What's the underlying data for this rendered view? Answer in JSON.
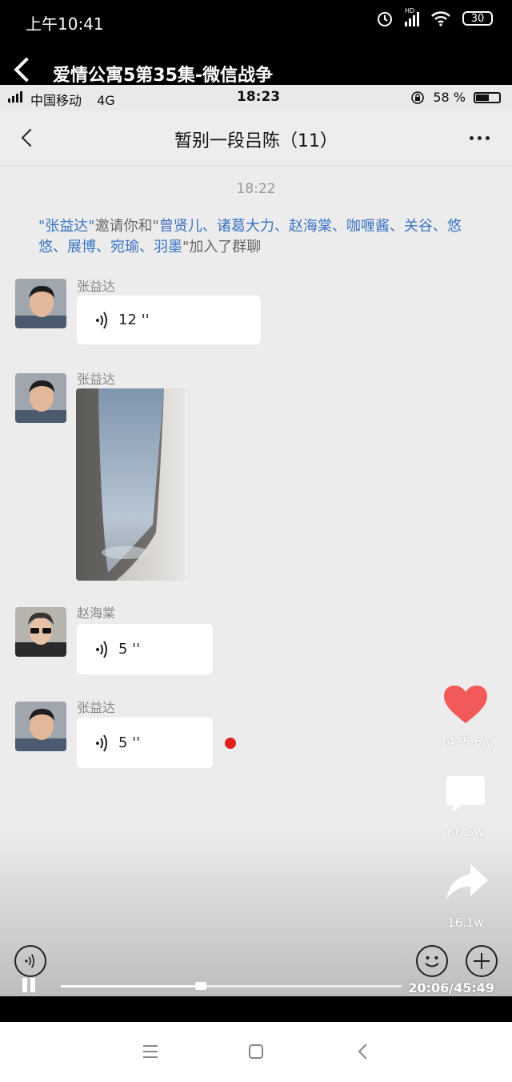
{
  "outer_status": {
    "time": "上午10:41",
    "hd": "HD",
    "battery": "30"
  },
  "video": {
    "title": "爱情公寓5第35集-微信战争"
  },
  "inner_status": {
    "carrier": "中国移动",
    "network": "4G",
    "time": "18:23",
    "battery": "58 %"
  },
  "chat": {
    "title": "暂别一段吕陈（11）",
    "timestamp": "18:22",
    "system_message": {
      "inviter": "\"张益达\"",
      "text1": "邀请你和\"",
      "invitees": "曾贤儿、诸葛大力、赵海棠、咖喱酱、关谷、悠悠、展博、宛瑜、羽墨",
      "text2": "\"加入了群聊"
    },
    "messages": [
      {
        "sender": "张益达",
        "duration": "12 ''"
      },
      {
        "sender": "张益达"
      },
      {
        "sender": "赵海棠",
        "duration": "5 ''"
      },
      {
        "sender": "张益达",
        "duration": "5 ''"
      }
    ]
  },
  "side_actions": {
    "likes": "1425.6w",
    "comments": "66.5w",
    "shares": "16.1w"
  },
  "player": {
    "time": "20:06/45:49",
    "progress": 0.41
  },
  "colors": {
    "like": "#f25a5a",
    "link": "#3b73c4",
    "unread": "#e0201d"
  }
}
